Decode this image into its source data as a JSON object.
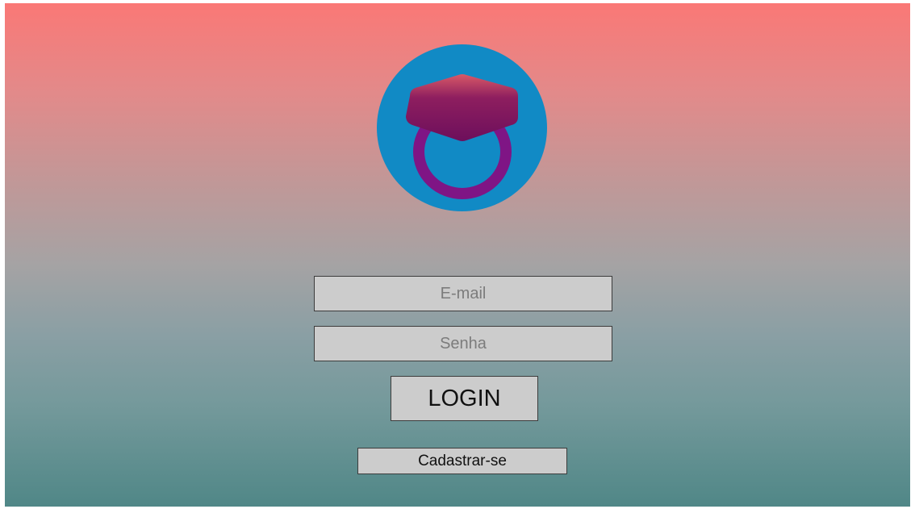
{
  "login_form": {
    "email_placeholder": "E-mail",
    "password_placeholder": "Senha",
    "login_label": "LOGIN",
    "signup_label": "Cadastrar-se"
  },
  "logo": {
    "icon": "graduation-cap-ring-icon",
    "circle_color": "#118ac5",
    "cap_color": "#6d0f5c",
    "ring_color": "#7f1585"
  },
  "colors": {
    "gradient_top": "#fa7876",
    "gradient_bottom": "#508787",
    "control_background": "#cccccc"
  }
}
